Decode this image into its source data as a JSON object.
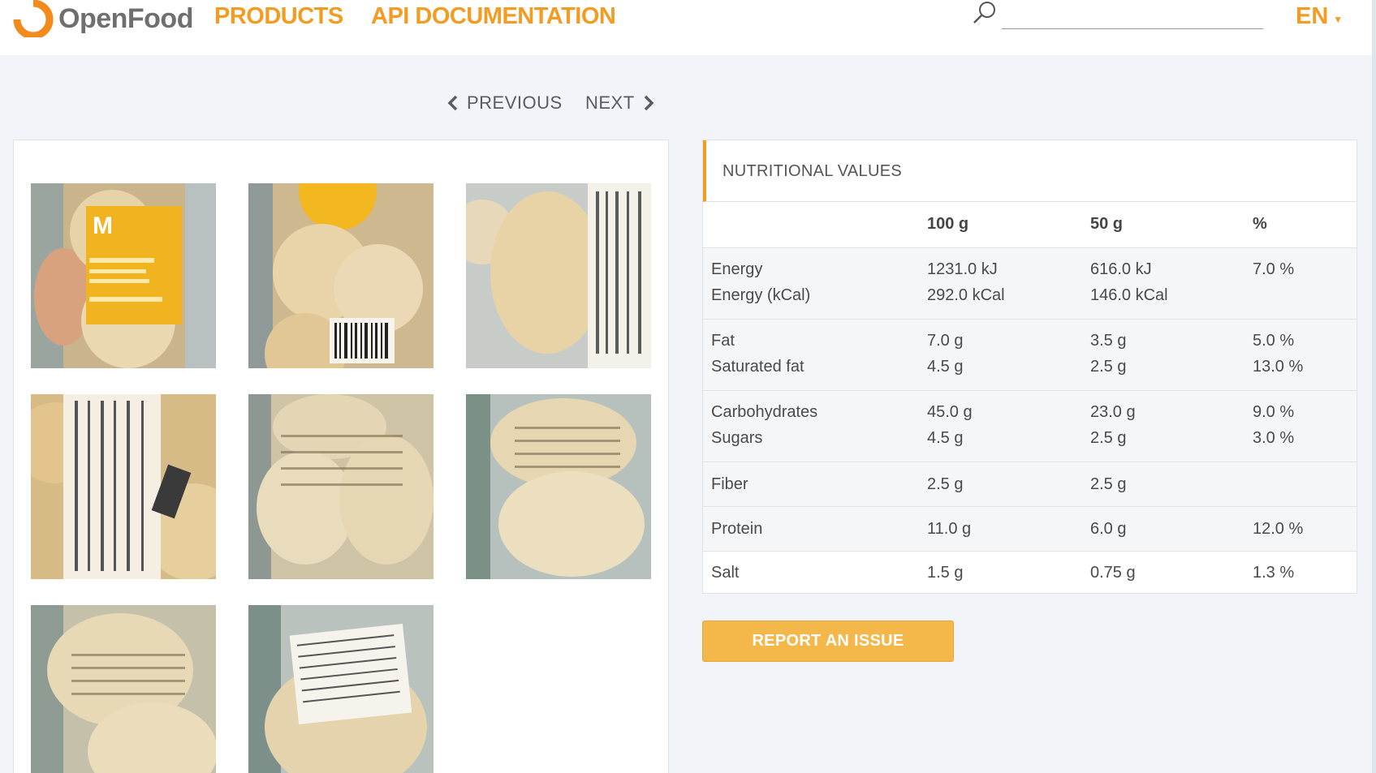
{
  "header": {
    "brand": "OpenFood",
    "nav": [
      {
        "label": "PRODUCTS"
      },
      {
        "label": "API DOCUMENTATION"
      }
    ],
    "search": {
      "value": "",
      "placeholder": ""
    },
    "language": "EN"
  },
  "pager": {
    "previous_label": "PREVIOUS",
    "next_label": "NEXT"
  },
  "gallery": {
    "image_count": 8
  },
  "nutrition": {
    "title": "NUTRITIONAL VALUES",
    "columns": [
      "100 g",
      "50 g",
      "%"
    ],
    "rows": [
      {
        "lines": [
          {
            "name": "Energy",
            "per100": "1231.0 kJ",
            "per50": "616.0 kJ",
            "pct": "7.0 %"
          },
          {
            "name": "Energy (kCal)",
            "per100": "292.0 kCal",
            "per50": "146.0 kCal",
            "pct": ""
          }
        ]
      },
      {
        "lines": [
          {
            "name": "Fat",
            "per100": "7.0 g",
            "per50": "3.5 g",
            "pct": "5.0 %"
          },
          {
            "name": "Saturated fat",
            "per100": "4.5 g",
            "per50": "2.5 g",
            "pct": "13.0 %"
          }
        ]
      },
      {
        "lines": [
          {
            "name": "Carbohydrates",
            "per100": "45.0 g",
            "per50": "23.0 g",
            "pct": "9.0 %"
          },
          {
            "name": "Sugars",
            "per100": "4.5 g",
            "per50": "2.5 g",
            "pct": "3.0 %"
          }
        ]
      },
      {
        "lines": [
          {
            "name": "Fiber",
            "per100": "2.5 g",
            "per50": "2.5 g",
            "pct": ""
          }
        ]
      },
      {
        "lines": [
          {
            "name": "Protein",
            "per100": "11.0 g",
            "per50": "6.0 g",
            "pct": "12.0 %"
          }
        ]
      },
      {
        "lines": [
          {
            "name": "Salt",
            "per100": "1.5 g",
            "per50": "0.75 g",
            "pct": "1.3 %"
          }
        ]
      }
    ]
  },
  "actions": {
    "report_label": "REPORT AN ISSUE"
  },
  "colors": {
    "accent": "#f39c23",
    "button": "#f3b74a",
    "background": "#f1f5f9"
  }
}
